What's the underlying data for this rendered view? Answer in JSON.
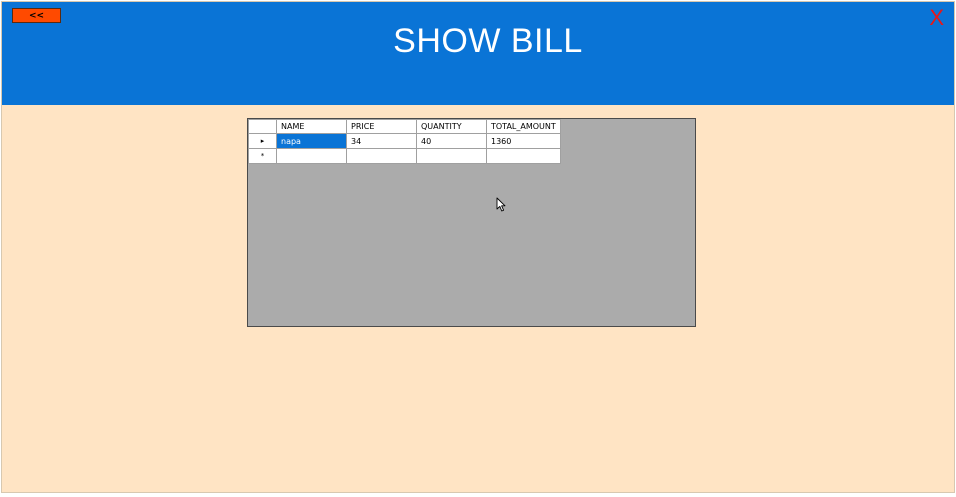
{
  "header": {
    "back_label": "<<",
    "title": "SHOW BILL",
    "close_label": "X"
  },
  "grid": {
    "columns": [
      "NAME",
      "PRICE",
      "QUANTITY",
      "TOTAL_AMOUNT"
    ],
    "rows": [
      {
        "indicator": "▸",
        "cells": [
          "napa",
          "34",
          "40",
          "1360"
        ]
      },
      {
        "indicator": "*",
        "cells": [
          "",
          "",
          "",
          ""
        ]
      }
    ],
    "selected_row": 0,
    "selected_column": 0
  },
  "colors": {
    "header_background": "#0a74d6",
    "window_background": "#ffe4c4",
    "grid_background": "#ababab",
    "back_button": "#ff4a00",
    "close_button": "#e81818",
    "selection": "#0a74d6"
  }
}
